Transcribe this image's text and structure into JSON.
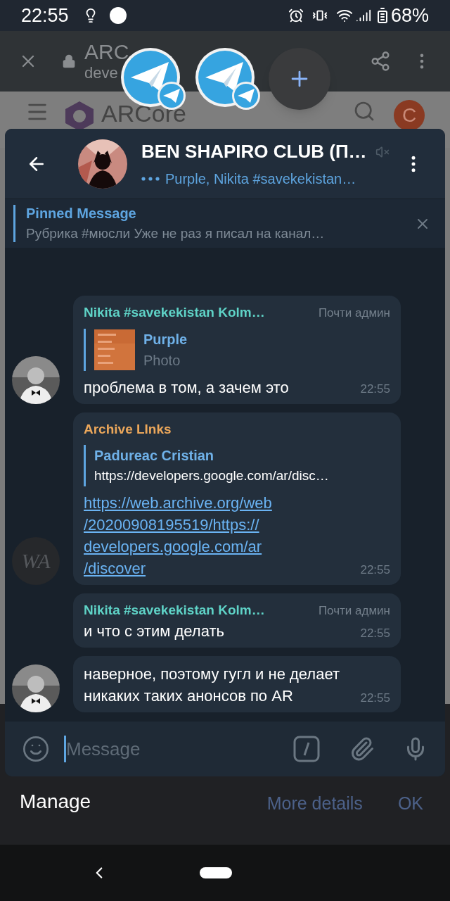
{
  "status_bar": {
    "time": "22:55",
    "battery": "68%"
  },
  "browser": {
    "title": "ARC",
    "url_visible": "deve",
    "site_name": "ARCore",
    "account_initial": "C"
  },
  "chat_heads": [
    {
      "kind": "telegram"
    },
    {
      "kind": "telegram"
    },
    {
      "kind": "add"
    }
  ],
  "chat": {
    "title": "BEN SHAPIRO CLUB (П…",
    "muted": true,
    "typing": "Purple, Nikita #savekekistan…",
    "pinned": {
      "label": "Pinned Message",
      "text": "Рубрика #мюсли  Уже не раз я писал на канал…"
    },
    "messages": [
      {
        "kind": "reply",
        "sender": "Nikita #savekekistan Kolm…",
        "color": "#5fd3c7",
        "badge": "Почти админ",
        "reply": {
          "name": "Purple",
          "text": "Photo",
          "thumbnail": true
        },
        "text": "проблема в том, а зачем это",
        "time": "22:55"
      },
      {
        "kind": "link",
        "sender": "Archive LInks",
        "color": "#eba75b",
        "reply": {
          "name": "Padureac Cristian",
          "text": "https://developers.google.com/ar/disc…",
          "thumbnail": false
        },
        "link_lines": [
          "https://web.archive.org/web",
          "/20200908195519/https://",
          "developers.google.com/ar",
          "/discover"
        ],
        "time": "22:55",
        "avatar": {
          "kind": "monogram",
          "text": "WA"
        }
      },
      {
        "kind": "text",
        "sender": "Nikita #savekekistan Kolm…",
        "color": "#5fd3c7",
        "badge": "Почти админ",
        "text": "и что с этим делать",
        "time": "22:55"
      },
      {
        "kind": "text",
        "text": "наверное, поэтому гугл и не делает никаких таких анонсов по AR",
        "time": "22:55"
      }
    ],
    "composer": {
      "placeholder": "Message"
    }
  },
  "notification": {
    "title": "Manage",
    "actions": [
      "More details",
      "OK"
    ]
  }
}
